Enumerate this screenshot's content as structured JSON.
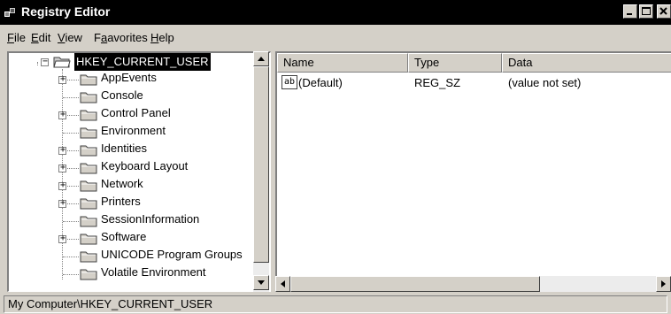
{
  "window": {
    "title": "Registry Editor"
  },
  "menu": [
    {
      "label": "ile",
      "accel": "F"
    },
    {
      "label": "dit",
      "accel": "E"
    },
    {
      "label": "iew",
      "accel": "V"
    },
    {
      "label": "avorites",
      "pre": "F",
      "accel": "a"
    },
    {
      "label": "elp",
      "accel": "H"
    }
  ],
  "tree": {
    "root": "HKEY_CURRENT_USER",
    "items": [
      {
        "label": "AppEvents",
        "expandable": true
      },
      {
        "label": "Console",
        "expandable": false
      },
      {
        "label": "Control Panel",
        "expandable": true
      },
      {
        "label": "Environment",
        "expandable": false
      },
      {
        "label": "Identities",
        "expandable": true
      },
      {
        "label": "Keyboard Layout",
        "expandable": true
      },
      {
        "label": "Network",
        "expandable": true
      },
      {
        "label": "Printers",
        "expandable": true
      },
      {
        "label": "SessionInformation",
        "expandable": false
      },
      {
        "label": "Software",
        "expandable": true
      },
      {
        "label": "UNICODE Program Groups",
        "expandable": false
      },
      {
        "label": "Volatile Environment",
        "expandable": false
      }
    ]
  },
  "list": {
    "columns": [
      "Name",
      "Type",
      "Data"
    ],
    "rows": [
      {
        "icon": "ab",
        "name": "(Default)",
        "type": "REG_SZ",
        "data": "(value not set)"
      }
    ]
  },
  "status": {
    "path": "My Computer\\HKEY_CURRENT_USER"
  },
  "colors": {
    "titlebar": "#000000",
    "selection": "#000000",
    "face": "#d4d0c8"
  }
}
